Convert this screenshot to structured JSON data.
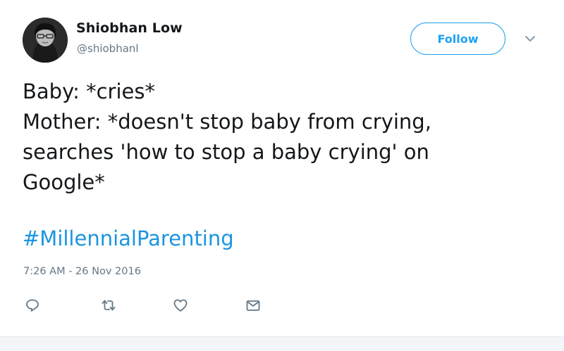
{
  "user": {
    "display_name": "Shiobhan Low",
    "handle": "@shiobhanl",
    "avatar_icon": "avatar-image"
  },
  "header": {
    "follow_label": "Follow",
    "menu_icon": "chevron-down-icon"
  },
  "tweet": {
    "lines": [
      "Baby: *cries*",
      "Mother: *doesn't stop baby from crying,",
      "searches 'how to stop a baby crying' on",
      "Google*"
    ],
    "hashtag": "#MillennialParenting",
    "timestamp": "7:26 AM - 26 Nov 2016"
  },
  "actions": [
    {
      "icon": "reply-icon"
    },
    {
      "icon": "retweet-icon"
    },
    {
      "icon": "like-icon"
    },
    {
      "icon": "direct-message-icon"
    }
  ],
  "colors": {
    "accent": "#1da1f2",
    "hashtag": "#1b95e0",
    "text": "#14171a",
    "secondary": "#657786"
  }
}
